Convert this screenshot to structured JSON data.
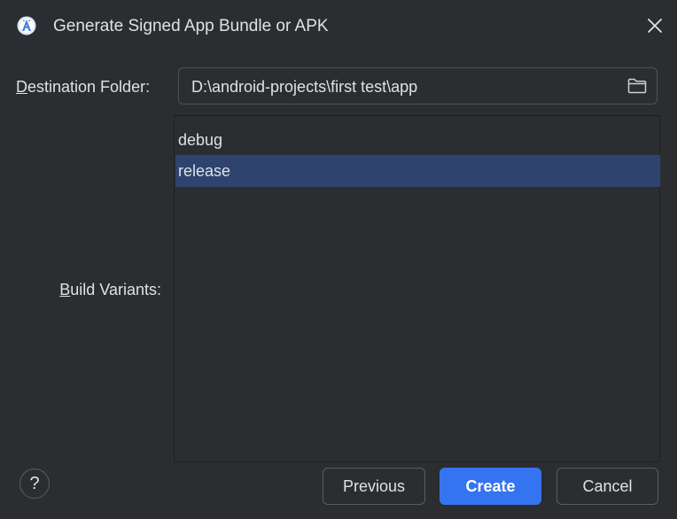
{
  "window": {
    "title": "Generate Signed App Bundle or APK",
    "app_icon": "android-studio-icon",
    "close_icon": "close-icon"
  },
  "destination": {
    "label_mnemonic": "D",
    "label_rest": "estination Folder:",
    "value": "D:\\android-projects\\first test\\app",
    "browse_icon": "folder-icon"
  },
  "build_variants": {
    "label_mnemonic": "B",
    "label_rest": "uild Variants:",
    "items": [
      {
        "label": "debug",
        "selected": false
      },
      {
        "label": "release",
        "selected": true
      }
    ]
  },
  "footer": {
    "help_label": "?",
    "previous_label": "Previous",
    "create_label": "Create",
    "cancel_label": "Cancel"
  },
  "colors": {
    "background": "#2b2d30",
    "selection": "#2e436e",
    "accent": "#3574f0",
    "text": "#dfe1e5"
  }
}
